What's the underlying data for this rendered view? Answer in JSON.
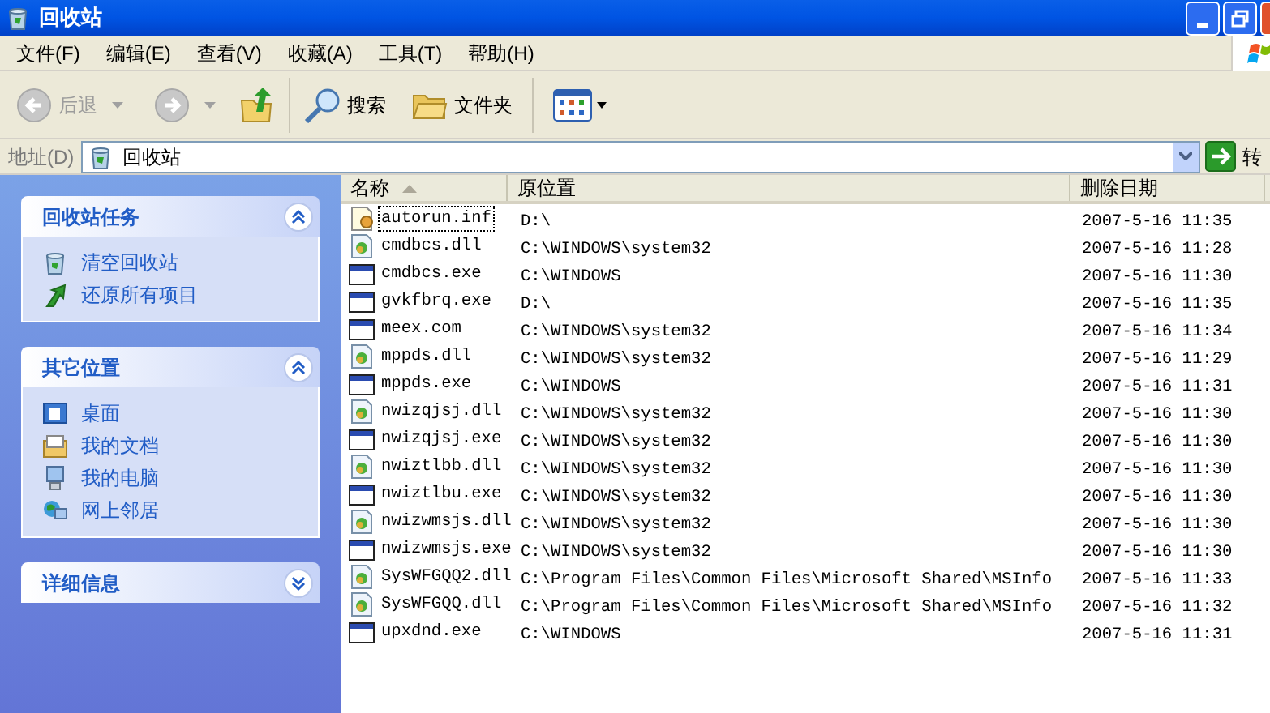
{
  "window": {
    "title": "回收站"
  },
  "menu": [
    "文件(F)",
    "编辑(E)",
    "查看(V)",
    "收藏(A)",
    "工具(T)",
    "帮助(H)"
  ],
  "toolbar": [
    {
      "kind": "back",
      "label": "后退",
      "disabled": true
    },
    {
      "kind": "forward",
      "disabled": true
    },
    {
      "kind": "up"
    },
    {
      "kind": "search",
      "label": "搜索"
    },
    {
      "kind": "folders",
      "label": "文件夹"
    },
    {
      "kind": "views"
    }
  ],
  "address": {
    "label": "地址(D)",
    "value": "回收站",
    "go": "转"
  },
  "panels": [
    {
      "title": "回收站任务",
      "expanded": true,
      "items": [
        {
          "kind": "bin",
          "label": "清空回收站"
        },
        {
          "kind": "restore",
          "label": "还原所有项目"
        }
      ]
    },
    {
      "title": "其它位置",
      "expanded": true,
      "items": [
        {
          "kind": "desktop",
          "label": "桌面"
        },
        {
          "kind": "docs",
          "label": "我的文档"
        },
        {
          "kind": "computer",
          "label": "我的电脑"
        },
        {
          "kind": "network",
          "label": "网上邻居"
        }
      ]
    },
    {
      "title": "详细信息",
      "expanded": false
    }
  ],
  "table": {
    "columns": [
      "名称",
      "原位置",
      "删除日期"
    ],
    "rows": [
      {
        "kind": "setup",
        "name": "autorun.inf",
        "location": "D:\\",
        "date": "2007-5-16 11:35",
        "focused": true
      },
      {
        "kind": "dll",
        "name": "cmdbcs.dll",
        "location": "C:\\WINDOWS\\system32",
        "date": "2007-5-16 11:28",
        "focused": false
      },
      {
        "kind": "app",
        "name": "cmdbcs.exe",
        "location": "C:\\WINDOWS",
        "date": "2007-5-16 11:30",
        "focused": false
      },
      {
        "kind": "app",
        "name": "gvkfbrq.exe",
        "location": "D:\\",
        "date": "2007-5-16 11:35",
        "focused": false
      },
      {
        "kind": "app",
        "name": "meex.com",
        "location": "C:\\WINDOWS\\system32",
        "date": "2007-5-16 11:34",
        "focused": false
      },
      {
        "kind": "dll",
        "name": "mppds.dll",
        "location": "C:\\WINDOWS\\system32",
        "date": "2007-5-16 11:29",
        "focused": false
      },
      {
        "kind": "app",
        "name": "mppds.exe",
        "location": "C:\\WINDOWS",
        "date": "2007-5-16 11:31",
        "focused": false
      },
      {
        "kind": "dll",
        "name": "nwizqjsj.dll",
        "location": "C:\\WINDOWS\\system32",
        "date": "2007-5-16 11:30",
        "focused": false
      },
      {
        "kind": "app",
        "name": "nwizqjsj.exe",
        "location": "C:\\WINDOWS\\system32",
        "date": "2007-5-16 11:30",
        "focused": false
      },
      {
        "kind": "dll",
        "name": "nwiztlbb.dll",
        "location": "C:\\WINDOWS\\system32",
        "date": "2007-5-16 11:30",
        "focused": false
      },
      {
        "kind": "app",
        "name": "nwiztlbu.exe",
        "location": "C:\\WINDOWS\\system32",
        "date": "2007-5-16 11:30",
        "focused": false
      },
      {
        "kind": "dll",
        "name": "nwizwmsjs.dll",
        "location": "C:\\WINDOWS\\system32",
        "date": "2007-5-16 11:30",
        "focused": false
      },
      {
        "kind": "app",
        "name": "nwizwmsjs.exe",
        "location": "C:\\WINDOWS\\system32",
        "date": "2007-5-16 11:30",
        "focused": false
      },
      {
        "kind": "dll",
        "name": "SysWFGQQ2.dll",
        "location": "C:\\Program Files\\Common Files\\Microsoft Shared\\MSInfo",
        "date": "2007-5-16 11:33",
        "focused": false
      },
      {
        "kind": "dll",
        "name": "SysWFGQQ.dll",
        "location": "C:\\Program Files\\Common Files\\Microsoft Shared\\MSInfo",
        "date": "2007-5-16 11:32",
        "focused": false
      },
      {
        "kind": "app",
        "name": "upxdnd.exe",
        "location": "C:\\WINDOWS",
        "date": "2007-5-16 11:31",
        "focused": false
      }
    ]
  }
}
